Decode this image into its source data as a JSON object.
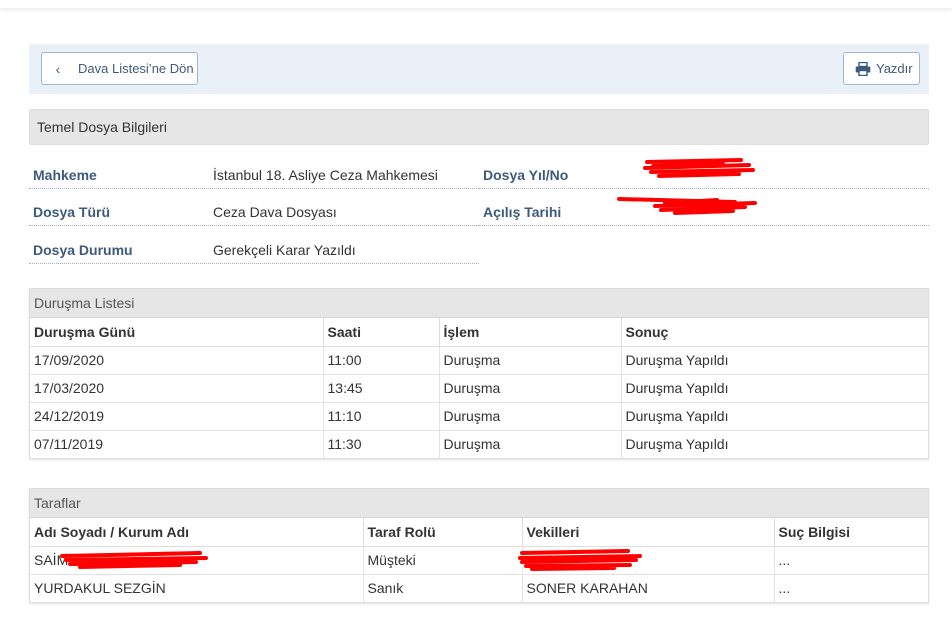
{
  "toolbar": {
    "back_label": "Dava Listesi’ne Dön",
    "print_label": "Yazdır"
  },
  "basic": {
    "title": "Temel Dosya Bilgileri",
    "court_label": "Mahkeme",
    "court_value": "İstanbul 18. Asliye Ceza Mahkemesi",
    "file_type_label": "Dosya Türü",
    "file_type_value": "Ceza Dava Dosyası",
    "file_status_label": "Dosya Durumu",
    "file_status_value": "Gerekçeli Karar Yazıldı",
    "file_no_label": "Dosya Yıl/No",
    "opening_date_label": "Açılış Tarihi"
  },
  "hearings": {
    "title": "Duruşma Listesi",
    "columns": [
      "Duruşma Günü",
      "Saati",
      "İşlem",
      "Sonuç"
    ],
    "rows": [
      [
        "17/09/2020",
        "11:00",
        "Duruşma",
        "Duruşma Yapıldı"
      ],
      [
        "17/03/2020",
        "13:45",
        "Duruşma",
        "Duruşma Yapıldı"
      ],
      [
        "24/12/2019",
        "11:10",
        "Duruşma",
        "Duruşma Yapıldı"
      ],
      [
        "07/11/2019",
        "11:30",
        "Duruşma",
        "Duruşma Yapıldı"
      ]
    ]
  },
  "parties": {
    "title": "Taraflar",
    "columns": [
      "Adı Soyadı / Kurum Adı",
      "Taraf Rolü",
      "Vekilleri",
      "Suç Bilgisi"
    ],
    "rows": [
      [
        "SAİM",
        "Müşteki",
        "",
        "..."
      ],
      [
        "YURDAKUL SEZGİN",
        "Sanık",
        "SONER KARAHAN",
        "..."
      ]
    ]
  },
  "icons": {
    "back": "chevron-left-icon",
    "print": "printer-icon"
  },
  "colors": {
    "accent": "#3d5a7c",
    "toolbar_bg": "#e9f0f8",
    "section_bg": "#e6e6e6",
    "redaction": "#ff0000"
  }
}
